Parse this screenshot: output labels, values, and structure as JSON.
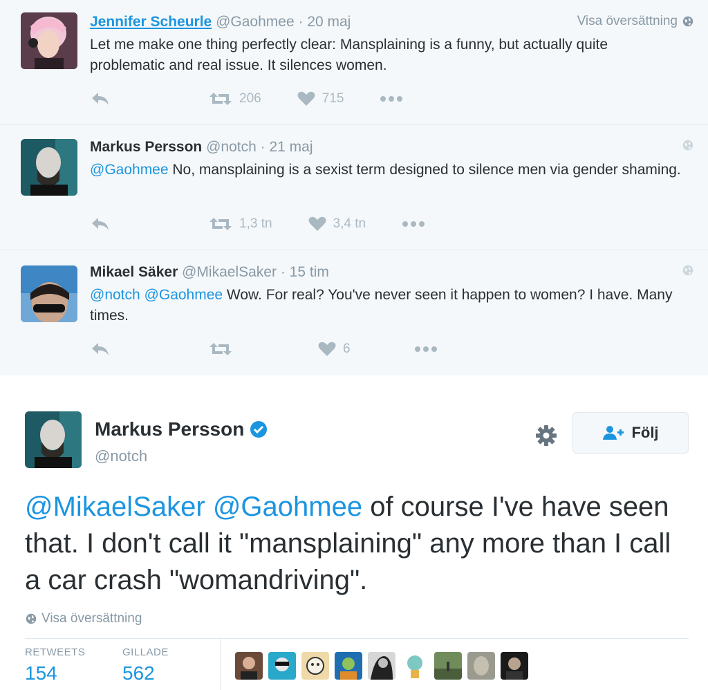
{
  "replies": [
    {
      "name": "Jennifer Scheurle",
      "handle": "@Gaohmee",
      "dot": "·",
      "time": "20 maj",
      "translate": "Visa översättning",
      "text": "Let me make one thing perfectly clear: Mansplaining is a funny, but actually quite problematic and real issue. It silences women.",
      "retweets": "206",
      "likes": "715"
    },
    {
      "name": "Markus Persson",
      "handle": "@notch",
      "dot": "·",
      "time": "21 maj",
      "mention": "@Gaohmee",
      "text": " No, mansplaining is a sexist term designed to silence men via gender shaming.",
      "retweets": "1,3 tn",
      "likes": "3,4 tn"
    },
    {
      "name": "Mikael Säker",
      "handle": "@MikaelSaker",
      "dot": "·",
      "time": "15 tim",
      "mention1": "@notch",
      "mention2": "@Gaohmee",
      "text": " Wow. For real? You've never seen it happen to women? I have. Many times.",
      "retweets": "",
      "likes": "6"
    }
  ],
  "main": {
    "name": "Markus Persson",
    "handle": "@notch",
    "follow_label": "Följ",
    "mention1": "@MikaelSaker",
    "mention2": "@Gaohmee",
    "text": " of course I've have seen that. I don't call it \"mansplaining\" any more than I call a car crash \"womandriving\".",
    "translate": "Visa översättning",
    "retweets_label": "RETWEETS",
    "retweets_value": "154",
    "likes_label": "GILLADE",
    "likes_value": "562"
  },
  "colors": {
    "link": "#1b95e0",
    "muted": "#8899a6",
    "thread_bg": "#f5f8fa"
  }
}
